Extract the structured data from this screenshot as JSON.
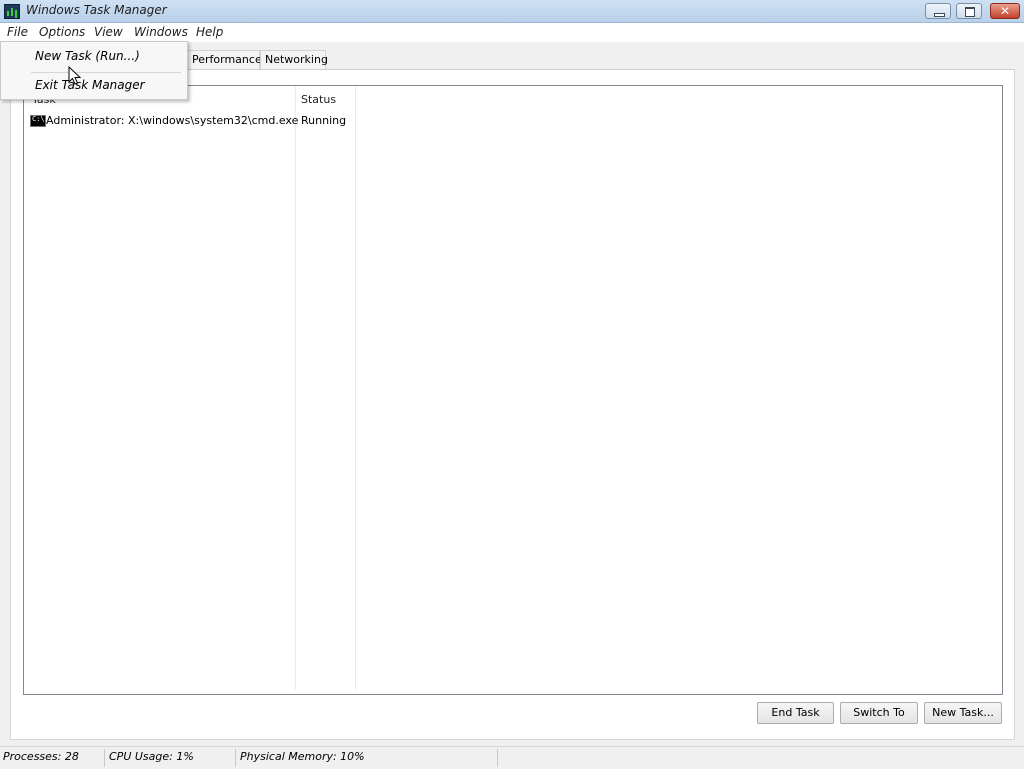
{
  "window": {
    "title": "Windows Task Manager",
    "controls": {
      "minimize": "minimize",
      "maximize": "restore",
      "close": "✕"
    }
  },
  "menubar": {
    "items": [
      "File",
      "Options",
      "View",
      "Windows",
      "Help"
    ]
  },
  "file_menu": {
    "items": [
      "New Task (Run...)",
      "Exit Task Manager"
    ]
  },
  "tabs": [
    "Performance",
    "Networking"
  ],
  "tasks_list": {
    "columns": [
      "Task",
      "Status"
    ],
    "rows": [
      {
        "icon": "cmd-icon",
        "task": "Administrator: X:\\windows\\system32\\cmd.exe",
        "status": "Running"
      }
    ]
  },
  "buttons": {
    "end_task": "End Task",
    "switch_to": "Switch To",
    "new_task": "New Task..."
  },
  "statusbar": {
    "processes": "Processes: 28",
    "cpu": "CPU Usage: 1%",
    "memory": "Physical Memory: 10%"
  }
}
